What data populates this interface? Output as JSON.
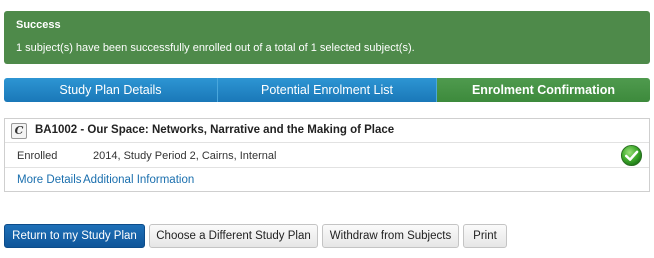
{
  "alert": {
    "title": "Success",
    "message": "1 subject(s) have been successfully enrolled out of a total of 1 selected subject(s).",
    "color": "#4e8a4a"
  },
  "steps": [
    {
      "label": "Study Plan Details",
      "active": false
    },
    {
      "label": "Potential Enrolment List",
      "active": false
    },
    {
      "label": "Enrolment Confirmation",
      "active": true
    }
  ],
  "subject": {
    "type_badge": "C",
    "title": "BA1002 - Our Space: Networks, Narrative and the Making of Place",
    "status_label": "Enrolled",
    "status_value": "2014, Study Period 2, Cairns, Internal",
    "status_icon": "check-circle-icon",
    "links": [
      "More Details",
      "Additional Information"
    ]
  },
  "buttons": {
    "return": "Return to my Study Plan",
    "choose": "Choose a Different Study Plan",
    "withdraw": "Withdraw from Subjects",
    "print": "Print"
  },
  "colors": {
    "step_blue": "#1f86c6",
    "step_green": "#4a944a",
    "primary_button": "#1565ad",
    "link": "#1a6fae"
  }
}
